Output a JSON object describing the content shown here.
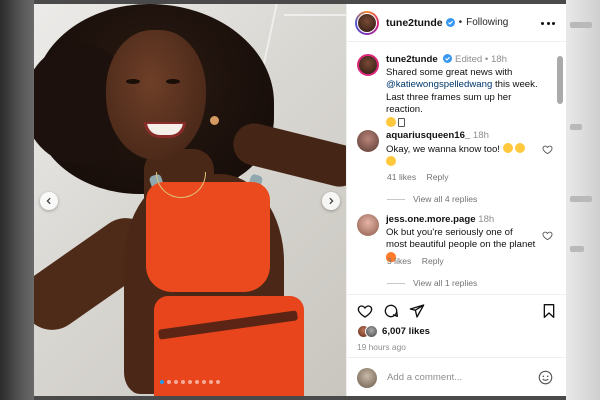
{
  "post": {
    "author": "tune2tunde",
    "follow_state": "Following",
    "separator": "•",
    "caption": {
      "username": "tune2tunde",
      "edited": "Edited",
      "time": "18h",
      "text_before": "Shared some great news with ",
      "mention": "@katiewongspelledwang",
      "text_after": " this week. Last three frames sum up her reaction."
    },
    "comments": [
      {
        "username": "aquariusqueen16_",
        "time": "18h",
        "text": "Okay, we wanna know too! ",
        "likes": "41 likes",
        "reply": "Reply",
        "view_replies": "View all 4 replies"
      },
      {
        "username": "jess.one.more.page",
        "time": "18h",
        "text": "Ok but you're seriously one of most beautiful people on the planet ",
        "likes": "3 likes",
        "reply": "Reply",
        "view_replies": "View all 1 replies"
      }
    ],
    "likes_count": "6,007 likes",
    "time_ago": "19 hours ago",
    "comment_placeholder": "Add a comment...",
    "carousel": {
      "slides": 9,
      "active_index": 0
    }
  },
  "colors": {
    "accent": "#1d9bf0",
    "verified": "#3897f0",
    "top_color": "#ea4a1d",
    "muted_text": "#737373"
  },
  "icons": [
    "verified-icon",
    "more-icon",
    "heart-icon",
    "comment-icon",
    "share-icon",
    "bookmark-icon",
    "emoji-icon",
    "chevron-left-icon",
    "chevron-right-icon"
  ]
}
